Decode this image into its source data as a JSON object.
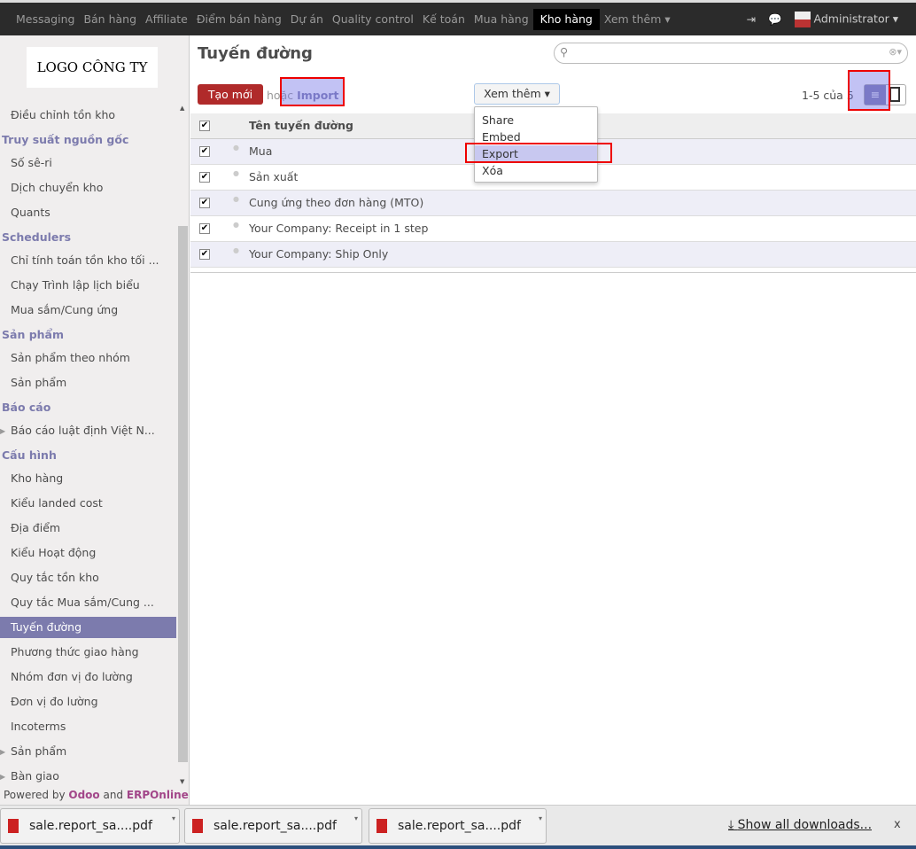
{
  "topbar": {
    "menu": [
      "Messaging",
      "Bán hàng",
      "Affiliate",
      "Điểm bán hàng",
      "Dự án",
      "Quality control",
      "Kế toán",
      "Mua hàng",
      "Kho hàng",
      "Xem thêm ▾"
    ],
    "active": "Kho hàng",
    "user": "Administrator ▾"
  },
  "sidebar": {
    "logo": "LOGO CÔNG TY",
    "items": [
      {
        "type": "item",
        "label": "Điều chỉnh tồn kho"
      },
      {
        "type": "head",
        "label": "Truy suất nguồn gốc"
      },
      {
        "type": "item",
        "label": "Số sê-ri"
      },
      {
        "type": "item",
        "label": "Dịch chuyển kho"
      },
      {
        "type": "item",
        "label": "Quants"
      },
      {
        "type": "head",
        "label": "Schedulers"
      },
      {
        "type": "item",
        "label": "Chỉ tính toán tồn kho tối ..."
      },
      {
        "type": "item",
        "label": "Chạy Trình lập lịch biểu"
      },
      {
        "type": "item",
        "label": "Mua sắm/Cung ứng"
      },
      {
        "type": "head",
        "label": "Sản phẩm"
      },
      {
        "type": "item",
        "label": "Sản phẩm theo nhóm"
      },
      {
        "type": "item",
        "label": "Sản phẩm"
      },
      {
        "type": "head",
        "label": "Báo cáo"
      },
      {
        "type": "item",
        "label": "Báo cáo luật định Việt N..."
      },
      {
        "type": "head",
        "label": "Cấu hình"
      },
      {
        "type": "item",
        "label": "Kho hàng"
      },
      {
        "type": "item",
        "label": "Kiểu landed cost"
      },
      {
        "type": "item",
        "label": "Địa điểm"
      },
      {
        "type": "item",
        "label": "Kiểu Hoạt động"
      },
      {
        "type": "item",
        "label": "Quy tắc tồn kho"
      },
      {
        "type": "item",
        "label": "Quy tắc Mua sắm/Cung ..."
      },
      {
        "type": "item",
        "label": "Tuyến đường",
        "selected": true
      },
      {
        "type": "item",
        "label": "Phương thức giao hàng"
      },
      {
        "type": "item",
        "label": "Nhóm đơn vị đo lường"
      },
      {
        "type": "item",
        "label": "Đơn vị đo lường"
      },
      {
        "type": "item",
        "label": "Incoterms"
      },
      {
        "type": "item",
        "label": "Sản phẩm"
      },
      {
        "type": "item",
        "label": "Bàn giao"
      }
    ],
    "powered_prefix": "Powered by ",
    "powered_odoo": "Odoo",
    "powered_and": " and ",
    "powered_erp": "ERPOnline"
  },
  "main": {
    "title": "Tuyến đường",
    "create_label": "Tạo mới",
    "or_label": "hoặc ",
    "import_label": "Import",
    "more_label": "Xem thêm ▾",
    "pager": "1-5 của 5",
    "column_header": "Tên tuyến đường",
    "rows": [
      "Mua",
      "Sản xuất",
      "Cung ứng theo đơn hàng (MTO)",
      "Your Company: Receipt in 1 step",
      "Your Company: Ship Only"
    ],
    "dropdown": [
      "Share",
      "Embed",
      "Export",
      "Xóa"
    ],
    "dropdown_selected": "Export"
  },
  "downloads": {
    "files": [
      "sale.report_sa....pdf",
      "sale.report_sa....pdf",
      "sale.report_sa....pdf"
    ],
    "show_all": "Show all downloads...",
    "close": "x"
  },
  "colors": {
    "accent": "#7c7bad",
    "create": "#b02a2a",
    "topbar": "#2b2b2b"
  }
}
